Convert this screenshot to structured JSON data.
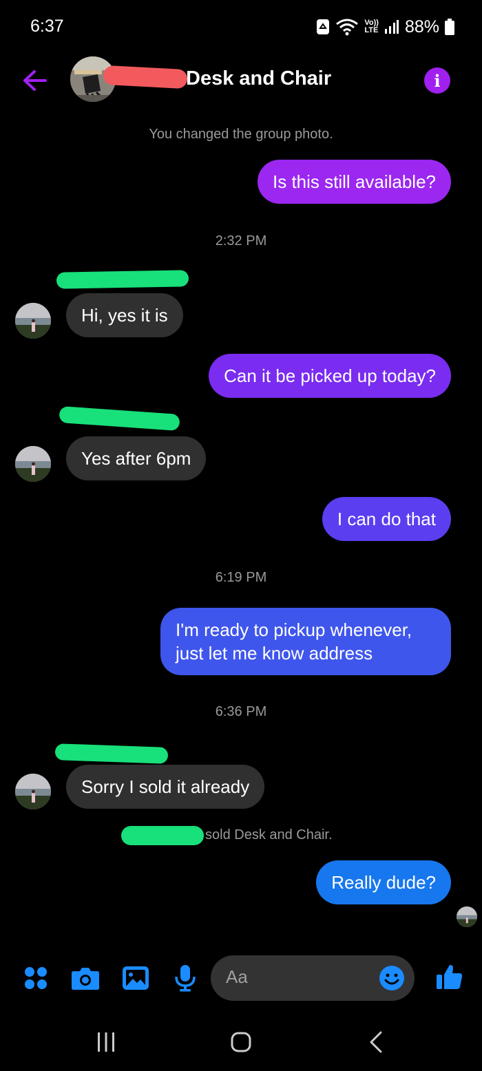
{
  "status": {
    "time": "6:37",
    "battery": "88%",
    "volte_top": "Vo))",
    "volte_bottom": "LTE"
  },
  "header": {
    "title": "Desk and Chair"
  },
  "messages": {
    "group_photo_note": "You changed the group photo.",
    "m1": "Is this still available?",
    "t1": "2:32 PM",
    "m2": "Hi, yes it is",
    "m3": "Can it be picked up today?",
    "m4": "Yes after 6pm",
    "m5": "I can do that",
    "t2": "6:19 PM",
    "m6": "I'm ready to pickup whenever, just let me know address",
    "t3": "6:36 PM",
    "m7": "Sorry I sold it already",
    "sold_note": "sold Desk and Chair.",
    "m8": "Really dude?"
  },
  "colors": {
    "bubble_1": "#9b27f0",
    "bubble_3": "#7a2cf0",
    "bubble_5": "#5b3ef0",
    "bubble_6": "#3f56ec",
    "bubble_8": "#1777ee",
    "incoming": "#303030",
    "accent_icons": "#1a8cff"
  },
  "composer": {
    "placeholder": "Aa"
  }
}
